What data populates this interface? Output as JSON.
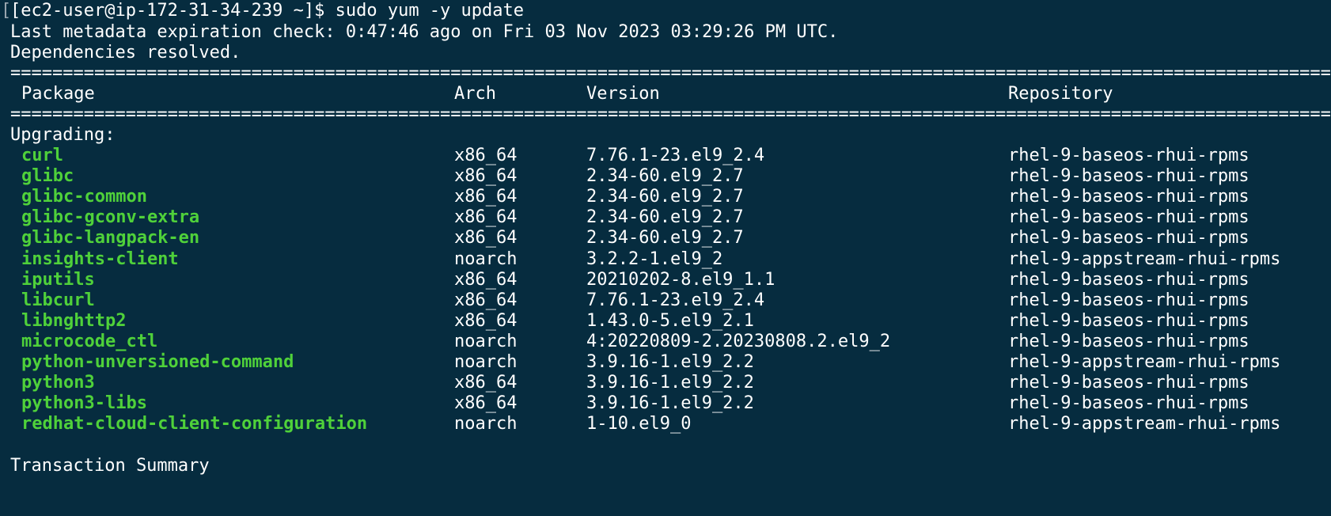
{
  "terminal": {
    "prompt": "[ec2-user@ip-172-31-34-239 ~]$ sudo yum -y update",
    "metadata_line": "Last metadata expiration check: 0:47:46 ago on Fri 03 Nov 2023 03:29:26 PM UTC.",
    "deps_line": "Dependencies resolved.",
    "separator": "================================================================================================================================================",
    "headers": {
      "package": "Package",
      "arch": "Arch",
      "version": "Version",
      "repository": "Repository"
    },
    "section_label": "Upgrading:",
    "packages": [
      {
        "name": "curl",
        "arch": "x86_64",
        "version": "7.76.1-23.el9_2.4",
        "repo": "rhel-9-baseos-rhui-rpms"
      },
      {
        "name": "glibc",
        "arch": "x86_64",
        "version": "2.34-60.el9_2.7",
        "repo": "rhel-9-baseos-rhui-rpms"
      },
      {
        "name": "glibc-common",
        "arch": "x86_64",
        "version": "2.34-60.el9_2.7",
        "repo": "rhel-9-baseos-rhui-rpms"
      },
      {
        "name": "glibc-gconv-extra",
        "arch": "x86_64",
        "version": "2.34-60.el9_2.7",
        "repo": "rhel-9-baseos-rhui-rpms"
      },
      {
        "name": "glibc-langpack-en",
        "arch": "x86_64",
        "version": "2.34-60.el9_2.7",
        "repo": "rhel-9-baseos-rhui-rpms"
      },
      {
        "name": "insights-client",
        "arch": "noarch",
        "version": "3.2.2-1.el9_2",
        "repo": "rhel-9-appstream-rhui-rpms"
      },
      {
        "name": "iputils",
        "arch": "x86_64",
        "version": "20210202-8.el9_1.1",
        "repo": "rhel-9-baseos-rhui-rpms"
      },
      {
        "name": "libcurl",
        "arch": "x86_64",
        "version": "7.76.1-23.el9_2.4",
        "repo": "rhel-9-baseos-rhui-rpms"
      },
      {
        "name": "libnghttp2",
        "arch": "x86_64",
        "version": "1.43.0-5.el9_2.1",
        "repo": "rhel-9-baseos-rhui-rpms"
      },
      {
        "name": "microcode_ctl",
        "arch": "noarch",
        "version": "4:20220809-2.20230808.2.el9_2",
        "repo": "rhel-9-baseos-rhui-rpms"
      },
      {
        "name": "python-unversioned-command",
        "arch": "noarch",
        "version": "3.9.16-1.el9_2.2",
        "repo": "rhel-9-appstream-rhui-rpms"
      },
      {
        "name": "python3",
        "arch": "x86_64",
        "version": "3.9.16-1.el9_2.2",
        "repo": "rhel-9-baseos-rhui-rpms"
      },
      {
        "name": "python3-libs",
        "arch": "x86_64",
        "version": "3.9.16-1.el9_2.2",
        "repo": "rhel-9-baseos-rhui-rpms"
      },
      {
        "name": "redhat-cloud-client-configuration",
        "arch": "noarch",
        "version": "1-10.el9_0",
        "repo": "rhel-9-appstream-rhui-rpms"
      }
    ],
    "summary_label": "Transaction Summary"
  },
  "colors": {
    "background": "#062c3f",
    "text": "#ffffff",
    "package_name": "#4fd13a"
  }
}
